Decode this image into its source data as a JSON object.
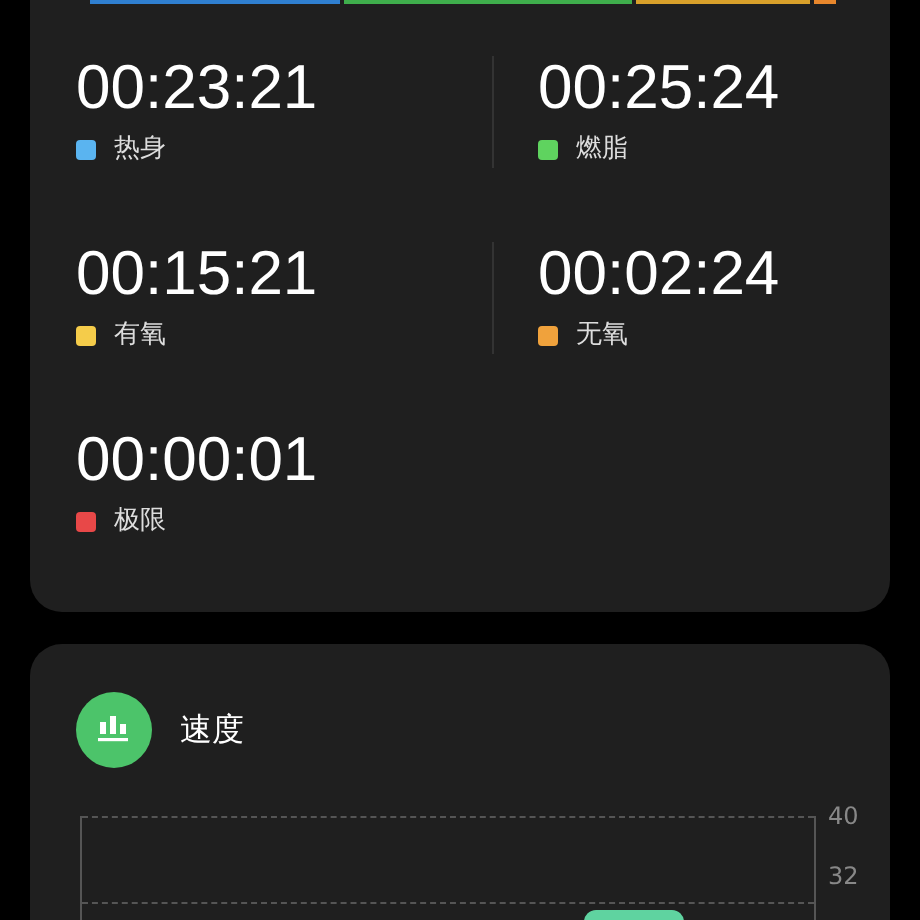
{
  "zone_bar": [
    {
      "color": "#2f7fd0"
    },
    {
      "color": "#3fae4c"
    },
    {
      "color": "#d8a02a"
    },
    {
      "color": "#e8872c"
    }
  ],
  "zones": [
    {
      "time": "00:23:21",
      "label": "热身",
      "color": "#5ab4f0"
    },
    {
      "time": "00:25:24",
      "label": "燃脂",
      "color": "#5fd35f"
    },
    {
      "time": "00:15:21",
      "label": "有氧",
      "color": "#f5cc4a"
    },
    {
      "time": "00:02:24",
      "label": "无氧",
      "color": "#f0a23c"
    },
    {
      "time": "00:00:01",
      "label": "极限",
      "color": "#e84848"
    }
  ],
  "speed": {
    "title": "速度",
    "y_ticks": [
      "40",
      "32"
    ]
  }
}
